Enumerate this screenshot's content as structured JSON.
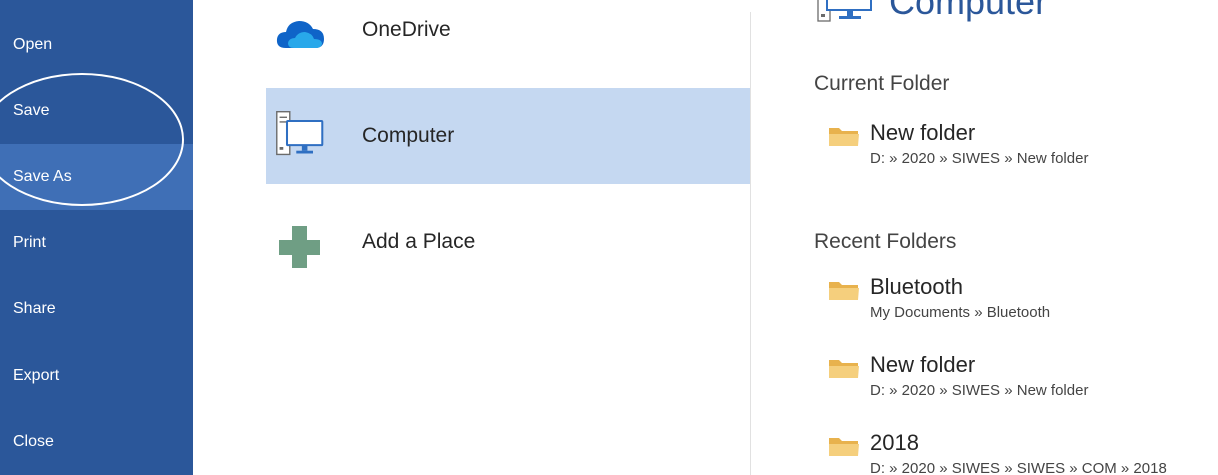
{
  "nav": {
    "items": [
      {
        "label": "Open"
      },
      {
        "label": "Save"
      },
      {
        "label": "Save As"
      },
      {
        "label": "Print"
      },
      {
        "label": "Share"
      },
      {
        "label": "Export"
      },
      {
        "label": "Close"
      }
    ],
    "active": "Save As"
  },
  "places": {
    "items": [
      {
        "label": "OneDrive",
        "icon": "cloud-icon"
      },
      {
        "label": "Computer",
        "icon": "computer-icon"
      },
      {
        "label": "Add a Place",
        "icon": "plus-icon"
      }
    ],
    "selected": "Computer"
  },
  "folders": {
    "heading": "Computer",
    "current_title": "Current Folder",
    "current": [
      {
        "name": "New folder",
        "path": "D: » 2020 » SIWES » New folder"
      }
    ],
    "recent_title": "Recent Folders",
    "recent": [
      {
        "name": "Bluetooth",
        "path": "My Documents » Bluetooth"
      },
      {
        "name": "New folder",
        "path": "D: » 2020 » SIWES » New folder"
      },
      {
        "name": "2018",
        "path": "D: » 2020 » SIWES » SIWES » COM » 2018"
      }
    ]
  },
  "colors": {
    "nav_bg": "#2b579a",
    "nav_active": "#3f6fb6",
    "selection": "#c5d8f1",
    "folder": "#f0c36b"
  }
}
